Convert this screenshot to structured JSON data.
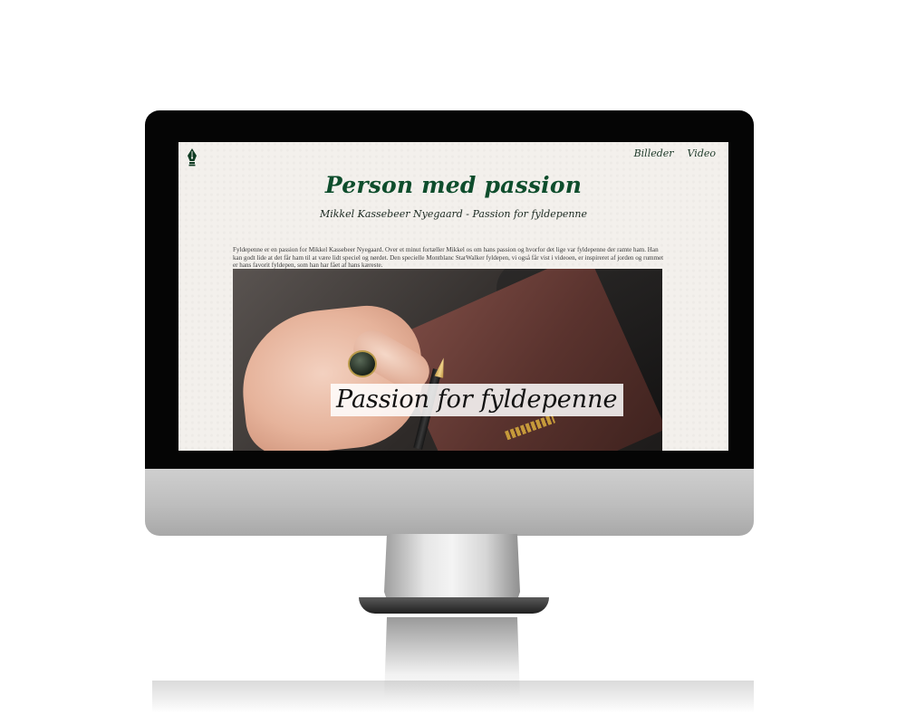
{
  "nav": {
    "links": [
      "Billeder",
      "Video"
    ]
  },
  "header": {
    "title": "Person med passion",
    "subtitle": "Mikkel Kassebeer Nyegaard - Passion for fyldepenne"
  },
  "intro": {
    "text": "Fyldepenne er en passion for Mikkel Kassebeer Nyegaard. Over et minut fortæller Mikkel os om hans passion og hvorfor det lige var fyldepenne der ramte ham. Han kan godt lide at det får ham til at være lidt speciel og nørdet. Den specielle Montblanc StarWalker fyldepen, vi også får vist i videoen, er inspireret af jorden og rummet er hans favorit fyldepen, som han har fået af hans kæreste."
  },
  "video": {
    "caption": "Passion for fyldepenne"
  },
  "colors": {
    "title_green": "#0e4d2c",
    "page_background": "#f3f0ec",
    "nav_text": "#1e3a2a"
  },
  "icons": {
    "logo": "fountain-pen-nib-icon"
  }
}
